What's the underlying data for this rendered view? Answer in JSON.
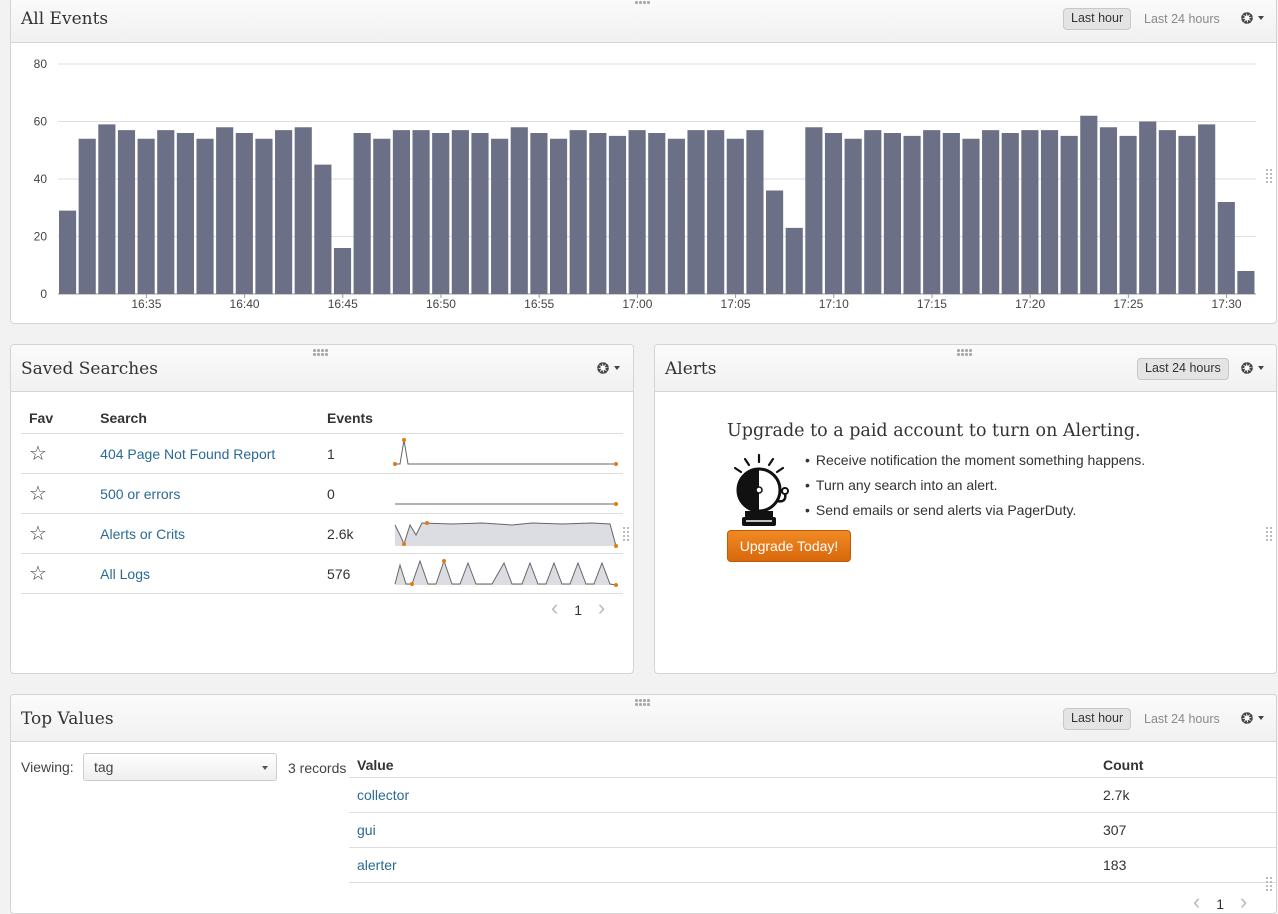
{
  "all_events": {
    "title": "All Events",
    "btn_last_hour": "Last hour",
    "btn_last_24": "Last 24 hours"
  },
  "chart_data": {
    "type": "bar",
    "title": "All Events",
    "xlabel": "",
    "ylabel": "",
    "ylim": [
      0,
      80
    ],
    "yticks": [
      "0",
      "20",
      "40",
      "60",
      "80"
    ],
    "xticks": [
      "16:35",
      "16:40",
      "16:45",
      "16:50",
      "16:55",
      "17:00",
      "17:05",
      "17:10",
      "17:15",
      "17:20",
      "17:25",
      "17:30"
    ],
    "values": [
      29,
      54,
      59,
      57,
      54,
      57,
      56,
      54,
      58,
      56,
      54,
      57,
      58,
      45,
      16,
      56,
      54,
      57,
      57,
      56,
      57,
      56,
      54,
      58,
      56,
      54,
      57,
      56,
      55,
      57,
      56,
      54,
      57,
      57,
      54,
      57,
      36,
      23,
      58,
      56,
      54,
      57,
      56,
      55,
      57,
      56,
      54,
      57,
      56,
      57,
      57,
      55,
      62,
      58,
      55,
      60,
      57,
      55,
      59,
      32,
      8
    ],
    "bar_color": "#6b7087",
    "grid": true
  },
  "saved_searches": {
    "title": "Saved Searches",
    "col_fav": "Fav",
    "col_search": "Search",
    "col_events": "Events",
    "rows": [
      {
        "name": "404 Page Not Found Report",
        "events": "1"
      },
      {
        "name": "500 or errors",
        "events": "0"
      },
      {
        "name": "Alerts or Crits",
        "events": "2.6k"
      },
      {
        "name": "All Logs",
        "events": "576"
      }
    ],
    "star_glyph": "☆",
    "page": "1",
    "prev_glyph": "‹",
    "next_glyph": "›"
  },
  "alerts": {
    "title": "Alerts",
    "btn_last_24": "Last 24 hours",
    "headline": "Upgrade to a paid account to turn on Alerting.",
    "bullets": [
      "Receive notification the moment something happens.",
      "Turn any search into an alert.",
      "Send emails or send alerts via PagerDuty."
    ],
    "upgrade_label": "Upgrade Today!",
    "accent_color": "#e2761a"
  },
  "top_values": {
    "title": "Top Values",
    "btn_last_hour": "Last hour",
    "btn_last_24": "Last 24 hours",
    "viewing_label": "Viewing:",
    "viewing_value": "tag",
    "records": "3 records",
    "col_value": "Value",
    "col_count": "Count",
    "rows": [
      {
        "value": "collector",
        "count": "2.7k"
      },
      {
        "value": "gui",
        "count": "307"
      },
      {
        "value": "alerter",
        "count": "183"
      }
    ],
    "page": "1"
  },
  "icons": {
    "gear": "gear-icon",
    "star": "star-icon",
    "bell": "alarm-bell-icon"
  }
}
